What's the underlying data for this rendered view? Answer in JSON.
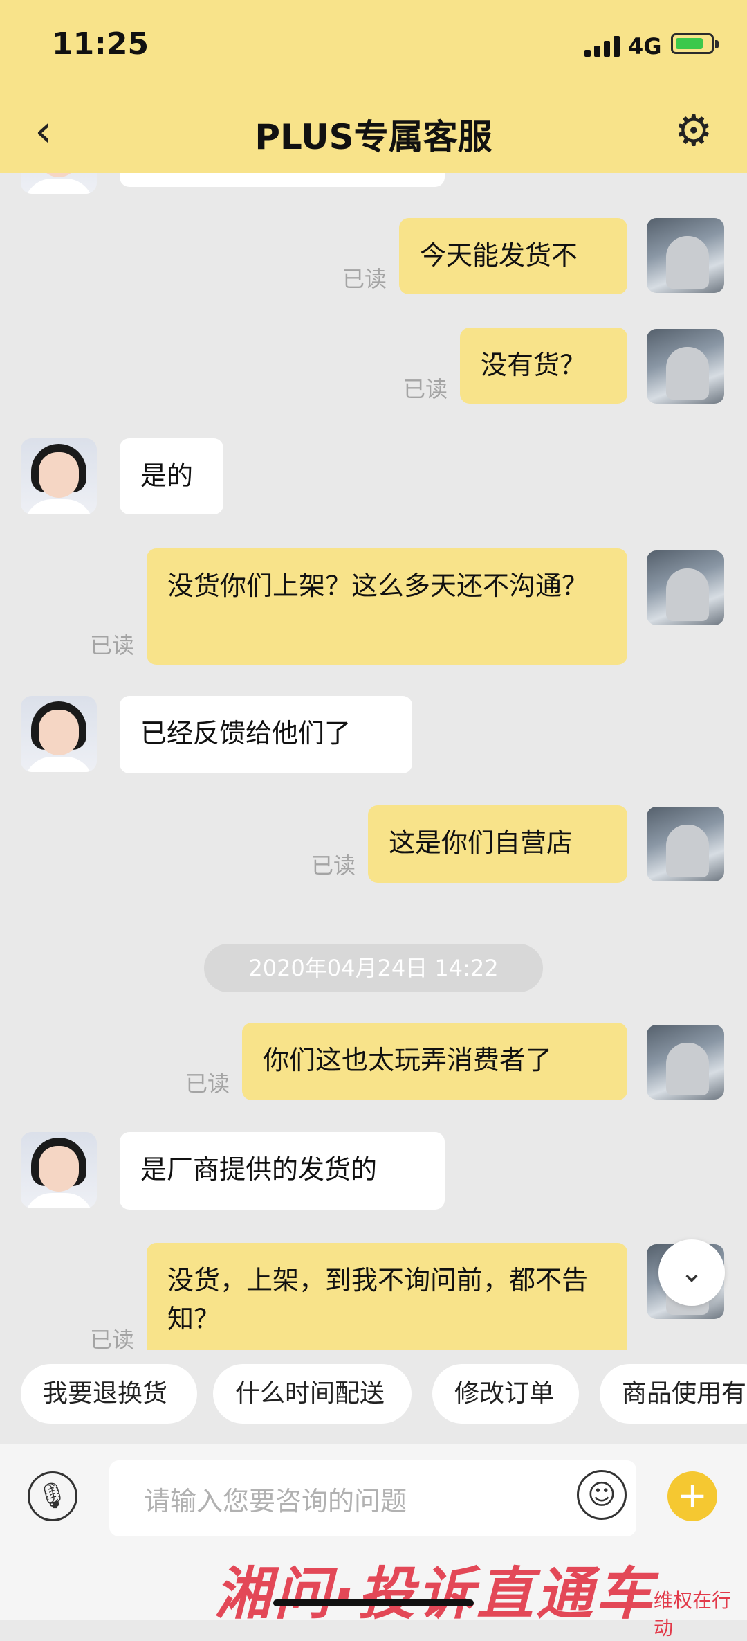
{
  "status_bar": {
    "time": "11:25",
    "network": "4G",
    "battery_level": 0.8
  },
  "header": {
    "title": "PLUS专属客服"
  },
  "messages": [
    {
      "sender": "user",
      "text": "今天能发货不",
      "read": "已读"
    },
    {
      "sender": "user",
      "text": "没有货？",
      "read": "已读"
    },
    {
      "sender": "agent",
      "text": "是的"
    },
    {
      "sender": "user",
      "text": "没货你们上架？这么多天还不沟通？",
      "read": "已读"
    },
    {
      "sender": "agent",
      "text": "已经反馈给他们了"
    },
    {
      "sender": "user",
      "text": "这是你们自营店",
      "read": "已读"
    },
    {
      "sender": "user",
      "text": "你们这也太玩弄消费者了",
      "read": "已读"
    },
    {
      "sender": "agent",
      "text": "是厂商提供的发货的"
    },
    {
      "sender": "user",
      "text": "没货，上架，到我不询问前，都不告知？",
      "read": "已读"
    }
  ],
  "timestamp": "2020年04月24日 14:22",
  "quick_replies": [
    "我要退换货",
    "什么时间配送",
    "修改订单",
    "商品使用有"
  ],
  "input": {
    "placeholder": "请输入您要咨询的问题"
  },
  "watermark": {
    "main": "湘问·投诉直通车",
    "sub": "维权在行动"
  }
}
